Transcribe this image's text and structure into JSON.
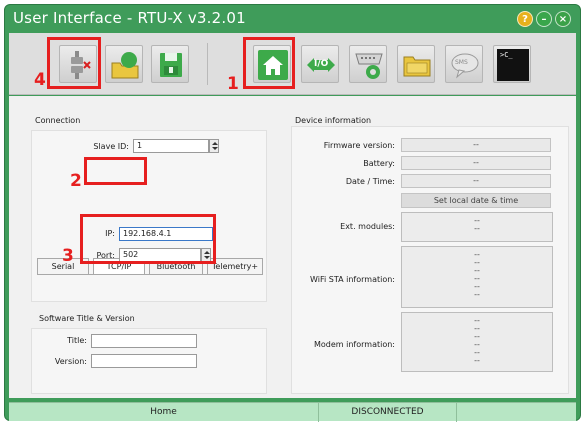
{
  "window": {
    "title": "User Interface - RTU-X v3.2.01"
  },
  "winbuttons": {
    "help": "?",
    "minimize": "–",
    "close": "×"
  },
  "toolbar": {
    "terminal_text": ">C_",
    "sms_text": "SMS",
    "io_text": "I/O"
  },
  "annotations": {
    "n1": "1",
    "n2": "2",
    "n3": "3",
    "n4": "4"
  },
  "connection": {
    "title": "Connection",
    "slave_id_label": "Slave ID:",
    "slave_id_value": "1",
    "tabs": [
      "Serial",
      "TCP/IP",
      "Bluetooth",
      "Telemetry+"
    ],
    "ip_label": "IP:",
    "ip_value": "192.168.4.1",
    "port_label": "Port:",
    "port_value": "502"
  },
  "software": {
    "title": "Software Title & Version",
    "title_label": "Title:",
    "version_label": "Version:",
    "title_value": "",
    "version_value": ""
  },
  "device": {
    "title": "Device information",
    "firmware_label": "Firmware version:",
    "firmware_value": "--",
    "battery_label": "Battery:",
    "battery_value": "--",
    "datetime_label": "Date / Time:",
    "datetime_value": "--",
    "set_date_button": "Set local date & time",
    "ext_modules_label": "Ext. modules:",
    "ext_modules_lines": [
      "--",
      "--"
    ],
    "wifi_label": "WiFi STA information:",
    "wifi_lines": [
      "--",
      "--",
      "--",
      "--",
      "--",
      "--"
    ],
    "modem_label": "Modem information:",
    "modem_lines": [
      "--",
      "--",
      "--",
      "--",
      "--",
      "--"
    ]
  },
  "status": {
    "left": "Home",
    "middle": "DISCONNECTED",
    "right": ""
  },
  "colors": {
    "window_green": "#3f9c5a",
    "status_green": "#b7e6c4",
    "annotation_red": "#e61f1f",
    "toolbar_gray": "#dedede",
    "icon_green": "#3daa4a",
    "icon_yellow": "#e9c63f"
  },
  "icons": [
    "disconnect-icon",
    "open-profile-icon",
    "save-icon",
    "home-icon",
    "io-icon",
    "serial-port-icon",
    "folder-icon",
    "sms-icon",
    "terminal-icon"
  ]
}
